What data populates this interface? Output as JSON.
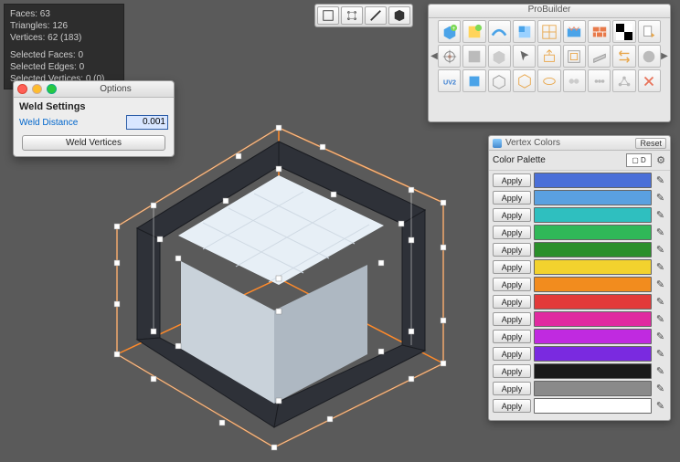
{
  "stats": {
    "faces_label": "Faces:",
    "faces": "63",
    "tris_label": "Triangles:",
    "tris": "126",
    "verts_label": "Vertices:",
    "verts": "62 (183)",
    "selfaces_label": "Selected Faces:",
    "selfaces": "0",
    "seledges_label": "Selected Edges:",
    "seledges": "0",
    "selverts_label": "Selected Vertices:",
    "selverts": "0 (0)"
  },
  "options": {
    "title": "Options",
    "header": "Weld Settings",
    "dist_label": "Weld Distance",
    "dist_value": "0.001",
    "button": "Weld Vertices"
  },
  "probuilder": {
    "title": "ProBuilder"
  },
  "vertex_colors": {
    "title": "Vertex Colors",
    "reset": "Reset",
    "palette_label": "Color Palette",
    "palette_sel": "▢ D",
    "apply_label": "Apply",
    "rows": [
      {
        "c": "#4a6fd8"
      },
      {
        "c": "#5aa0e0"
      },
      {
        "c": "#2fbfbf"
      },
      {
        "c": "#30b858"
      },
      {
        "c": "#2a8f2a"
      },
      {
        "c": "#f2d22e"
      },
      {
        "c": "#f28c1e"
      },
      {
        "c": "#e23a3a"
      },
      {
        "c": "#e02aa0"
      },
      {
        "c": "#c02ae0"
      },
      {
        "c": "#7a2ae0"
      },
      {
        "c": "#1a1a1a"
      },
      {
        "c": "#8a8a8a"
      },
      {
        "c": "#ffffff"
      }
    ]
  },
  "chart_data": {
    "type": "table",
    "note": "no chart in image"
  }
}
